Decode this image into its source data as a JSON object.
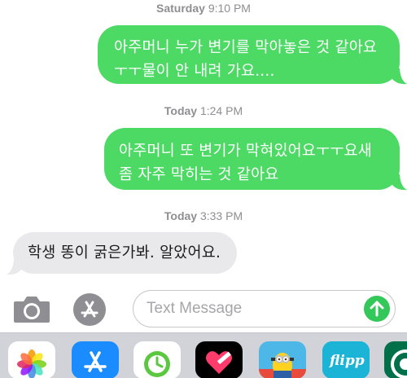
{
  "conversation": {
    "timestamps": [
      {
        "day": "Saturday",
        "time": "9:10 PM"
      },
      {
        "day": "Today",
        "time": "1:24 PM"
      },
      {
        "day": "Today",
        "time": "3:33 PM"
      }
    ],
    "messages": [
      {
        "direction": "sent",
        "lines": [
          "아주머니 누가 변기를 막아놓은 것 같아요",
          "ㅜㅜ물이 안 내려 가요...."
        ]
      },
      {
        "direction": "sent",
        "lines": [
          "아주머니 또 변기가 막혀있어요ㅜㅜ요새",
          "좀 자주 막히는 것 같아요"
        ]
      },
      {
        "direction": "received",
        "lines": [
          "학생 똥이 굵은가봐. 알았어요."
        ]
      }
    ]
  },
  "composer": {
    "placeholder": "Text Message"
  },
  "icons": {
    "camera": "camera-icon",
    "app_store": "app-store-icon",
    "send": "arrow-up-icon"
  },
  "app_drawer": {
    "apps": [
      "photos-icon",
      "app-store-icon",
      "clock-icon",
      "heart-icon",
      "minions-icon",
      "flipp-icon",
      "starbucks-icon"
    ],
    "flipp_label": "flipp"
  },
  "colors": {
    "sent_bubble": "#4cd964",
    "received_bubble": "#e9e9eb",
    "timestamp": "#8e8e93",
    "send_button": "#34c759",
    "drawer": "#d1d3d9"
  }
}
